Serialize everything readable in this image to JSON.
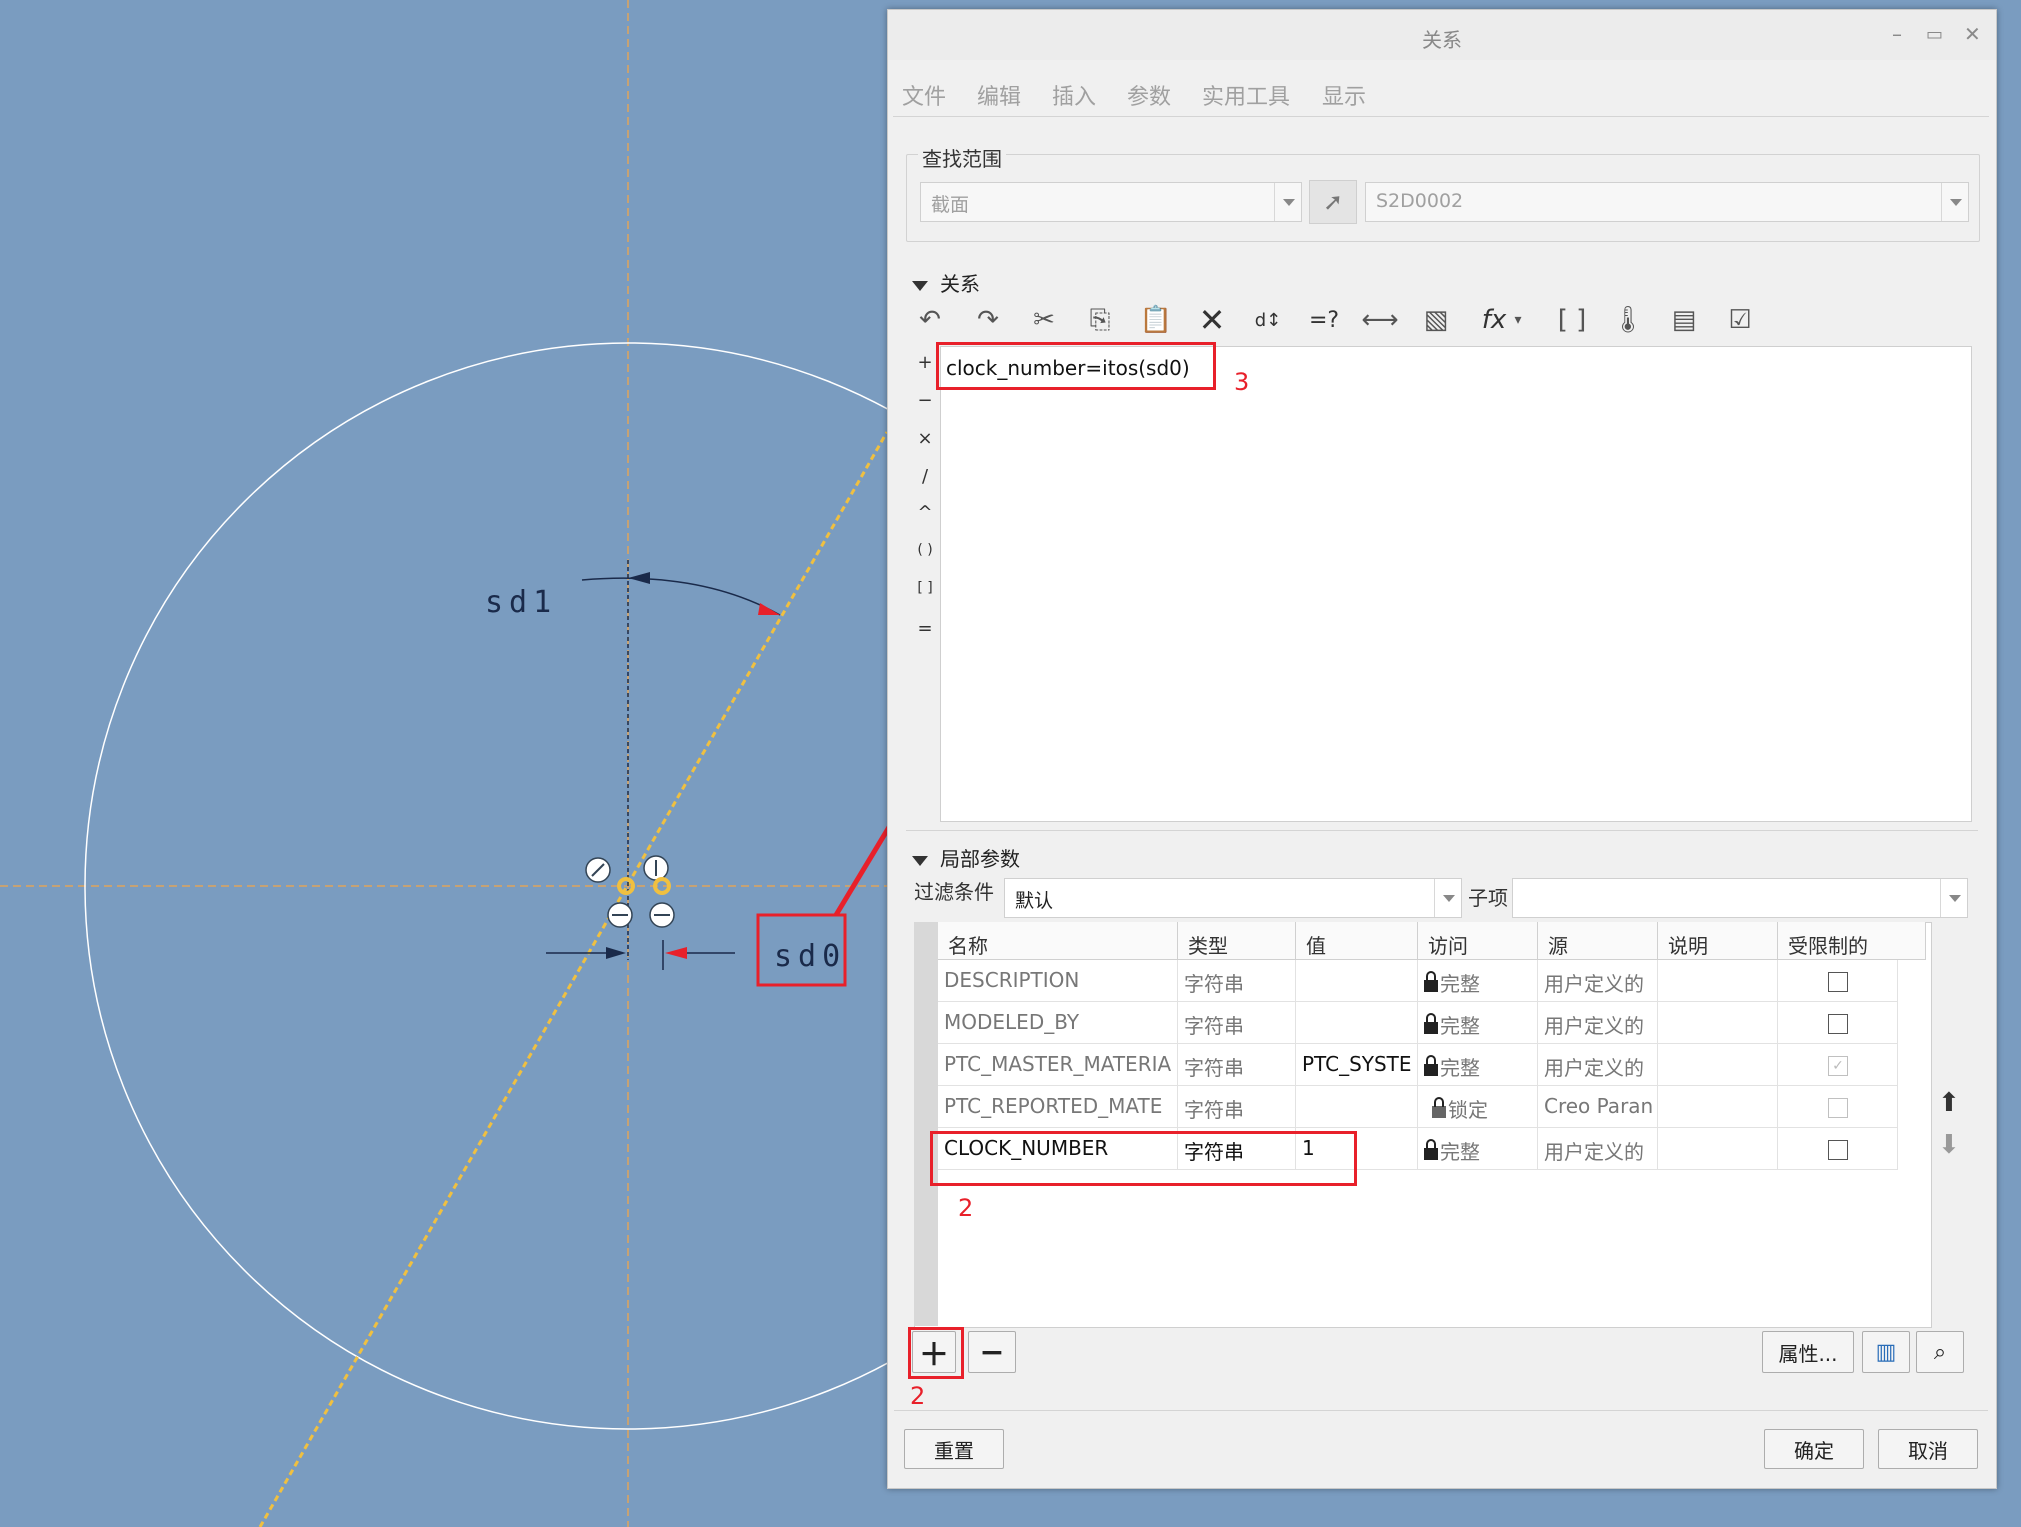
{
  "canvas": {
    "dim_sd1": "sd1",
    "dim_sd0": "sd0"
  },
  "dialog": {
    "title": "关系",
    "menu": [
      "文件",
      "编辑",
      "插入",
      "参数",
      "实用工具",
      "显示"
    ],
    "lookup": {
      "label": "查找范围",
      "scope_value": "截面",
      "item_value": "S2D0002"
    },
    "relations": {
      "label": "关系",
      "code_line": "clock_number=itos(sd0)",
      "side_symbols": [
        "+",
        "−",
        "×",
        "/",
        "^",
        "( )",
        "[ ]",
        "="
      ]
    },
    "local_params": {
      "label": "局部参数",
      "filter_label": "过滤条件",
      "filter_value": "默认",
      "subitem_label": "子项",
      "columns": [
        "名称",
        "类型",
        "值",
        "访问",
        "源",
        "说明",
        "受限制的"
      ],
      "rows": [
        {
          "name": "DESCRIPTION",
          "type": "字符串",
          "value": "",
          "access": "完整",
          "source": "用户定义的",
          "note": "",
          "restricted": false,
          "dim": false
        },
        {
          "name": "MODELED_BY",
          "type": "字符串",
          "value": "",
          "access": "完整",
          "source": "用户定义的",
          "note": "",
          "restricted": false,
          "dim": false
        },
        {
          "name": "PTC_MASTER_MATERIA",
          "type": "字符串",
          "value": "PTC_SYSTE",
          "access": "完整",
          "source": "用户定义的",
          "note": "",
          "restricted": true,
          "dim": true
        },
        {
          "name": "PTC_REPORTED_MATE",
          "type": "字符串",
          "value": "",
          "access": "锁定",
          "source": "Creo Paran",
          "note": "",
          "restricted": false,
          "dim": true
        },
        {
          "name": "CLOCK_NUMBER",
          "type": "字符串",
          "value": "1",
          "access": "完整",
          "source": "用户定义的",
          "note": "",
          "restricted": false,
          "dim": false
        }
      ],
      "properties_button": "属性..."
    },
    "buttons": {
      "reset": "重置",
      "ok": "确定",
      "cancel": "取消"
    },
    "annotations": {
      "step2_row": "2",
      "step2_add": "2",
      "step3": "3"
    }
  }
}
